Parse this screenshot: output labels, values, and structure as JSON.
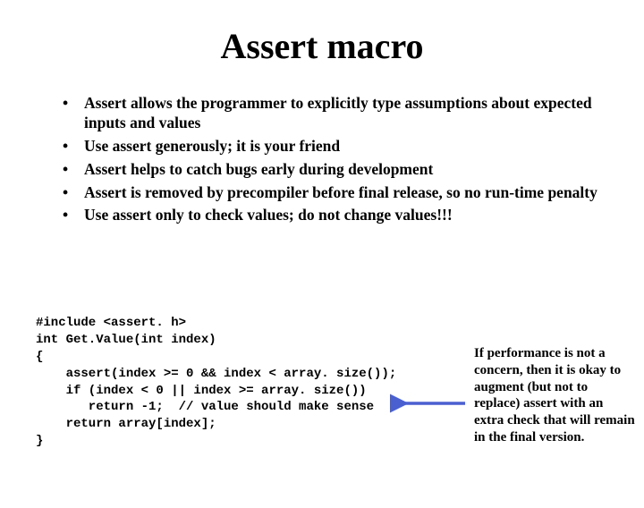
{
  "title": "Assert macro",
  "bullets": [
    "Assert allows the programmer to explicitly type assumptions about expected inputs and values",
    "Use assert generously; it is your friend",
    "Assert helps to catch bugs early during development",
    "Assert is removed by precompiler before final release, so no run-time penalty",
    "Use assert only to check values; do not change values!!!"
  ],
  "code": {
    "l0": "#include <assert. h>",
    "l1": "int Get.Value(int index)",
    "l2": "{",
    "l3": "    assert(index >= 0 && index < array. size());",
    "l4": "    if (index < 0 || index >= array. size())",
    "l5": "       return -1;  // value should make sense",
    "l6": "    return array[index];",
    "l7": "}"
  },
  "note": "If performance is not a concern, then it is okay to augment (but not to replace) assert with an extra check that will remain in the final version.",
  "arrow_color": "#4a5fd0"
}
